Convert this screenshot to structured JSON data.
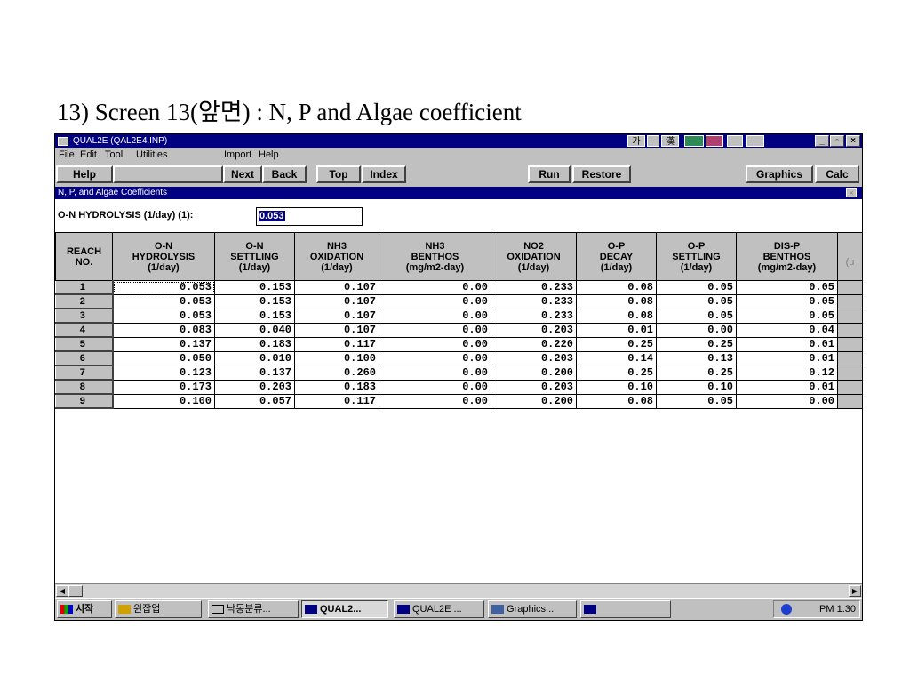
{
  "slide_title": "13) Screen 13(앞면) : N, P and Algae coefficient",
  "window": {
    "title": "QUAL2E (QAL2E4.INP)",
    "ime_labels": [
      "가",
      "漢"
    ],
    "controls": [
      "_",
      "▫",
      "×"
    ]
  },
  "menu": [
    "File",
    "Edit",
    "Tool",
    "Utilities",
    "Import",
    "Help"
  ],
  "toolbar": {
    "help": "Help",
    "next": "Next",
    "back": "Back",
    "top": "Top",
    "index": "Index",
    "run": "Run",
    "restore": "Restore",
    "graphics": "Graphics",
    "calc": "Calc"
  },
  "subwindow": {
    "title": "N, P, and Algae Coefficients",
    "close": "×"
  },
  "field": {
    "label": "O-N HYDROLYSIS (1/day) (1):",
    "value": "0.053"
  },
  "table": {
    "headers": [
      [
        "REACH",
        "NO."
      ],
      [
        "O-N",
        "HYDROLYSIS",
        "(1/day)"
      ],
      [
        "O-N",
        "SETTLING",
        "(1/day)"
      ],
      [
        "NH3",
        "OXIDATION",
        "(1/day)"
      ],
      [
        "NH3",
        "BENTHOS",
        "(mg/m2-day)"
      ],
      [
        "NO2",
        "OXIDATION",
        "(1/day)"
      ],
      [
        "O-P",
        "DECAY",
        "(1/day)"
      ],
      [
        "O-P",
        "SETTLING",
        "(1/day)"
      ],
      [
        "DIS-P",
        "BENTHOS",
        "(mg/m2-day)"
      ]
    ],
    "partial_header": "(u",
    "rows": [
      [
        "1",
        "0.053",
        "0.153",
        "0.107",
        "0.00",
        "0.233",
        "0.08",
        "0.05",
        "0.05"
      ],
      [
        "2",
        "0.053",
        "0.153",
        "0.107",
        "0.00",
        "0.233",
        "0.08",
        "0.05",
        "0.05"
      ],
      [
        "3",
        "0.053",
        "0.153",
        "0.107",
        "0.00",
        "0.233",
        "0.08",
        "0.05",
        "0.05"
      ],
      [
        "4",
        "0.083",
        "0.040",
        "0.107",
        "0.00",
        "0.203",
        "0.01",
        "0.00",
        "0.04"
      ],
      [
        "5",
        "0.137",
        "0.183",
        "0.117",
        "0.00",
        "0.220",
        "0.25",
        "0.25",
        "0.01"
      ],
      [
        "6",
        "0.050",
        "0.010",
        "0.100",
        "0.00",
        "0.203",
        "0.14",
        "0.13",
        "0.01"
      ],
      [
        "7",
        "0.123",
        "0.137",
        "0.260",
        "0.00",
        "0.200",
        "0.25",
        "0.25",
        "0.12"
      ],
      [
        "8",
        "0.173",
        "0.203",
        "0.183",
        "0.00",
        "0.203",
        "0.10",
        "0.10",
        "0.01"
      ],
      [
        "9",
        "0.100",
        "0.057",
        "0.117",
        "0.00",
        "0.200",
        "0.08",
        "0.05",
        "0.00"
      ]
    ]
  },
  "taskbar": {
    "start": "시작",
    "tasks": [
      "윈잡업",
      "낙동분류...",
      "QUAL2...",
      "QUAL2E ...",
      "Graphics...",
      ""
    ],
    "clock": "PM 1:30"
  }
}
